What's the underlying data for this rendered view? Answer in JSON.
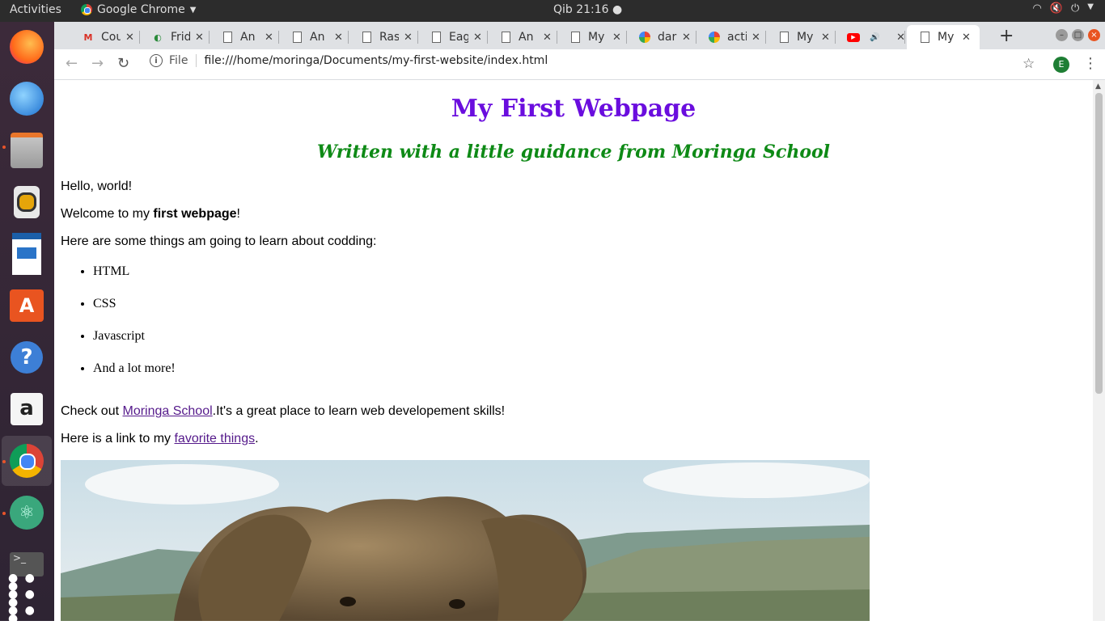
{
  "system": {
    "activities": "Activities",
    "app_menu": "Google Chrome",
    "clock": "Qib 21:16"
  },
  "tabs": [
    {
      "title": "Cou",
      "icon": "gmail-icon"
    },
    {
      "title": "Frid",
      "icon": "site-icon"
    },
    {
      "title": "An",
      "icon": "page-icon"
    },
    {
      "title": "An",
      "icon": "page-icon"
    },
    {
      "title": "Ras",
      "icon": "page-icon"
    },
    {
      "title": "Eag",
      "icon": "page-icon"
    },
    {
      "title": "An",
      "icon": "page-icon"
    },
    {
      "title": "My",
      "icon": "page-icon"
    },
    {
      "title": "dar",
      "icon": "google-icon"
    },
    {
      "title": "acti",
      "icon": "google-icon"
    },
    {
      "title": "My",
      "icon": "page-icon"
    },
    {
      "title": "",
      "icon": "youtube-icon"
    },
    {
      "title": "My",
      "icon": "page-icon",
      "active": true
    }
  ],
  "toolbar": {
    "scheme": "File",
    "url": "file:///home/moringa/Documents/my-first-website/index.html",
    "profile_initial": "E"
  },
  "page": {
    "title": "My First Webpage",
    "subtitle": "Written with a little guidance from Moringa School",
    "hello": "Hello, world!",
    "welcome_pre": "Welcome to my ",
    "welcome_bold": "first webpage",
    "welcome_post": "!",
    "learn_intro": "Here are some things am going to learn about codding:",
    "learn_items": [
      "HTML",
      "CSS",
      "Javascript",
      "And a lot more!"
    ],
    "check_pre": "Check out ",
    "check_link": "Moringa School",
    "check_post": ".It's a great place to learn web developement skills!",
    "fav_pre": "Here is a link to my ",
    "fav_link": "favorite things",
    "fav_post": "."
  },
  "colors": {
    "title": "#6a0dde",
    "subtitle": "#0e8a16",
    "link": "#551a8b"
  }
}
